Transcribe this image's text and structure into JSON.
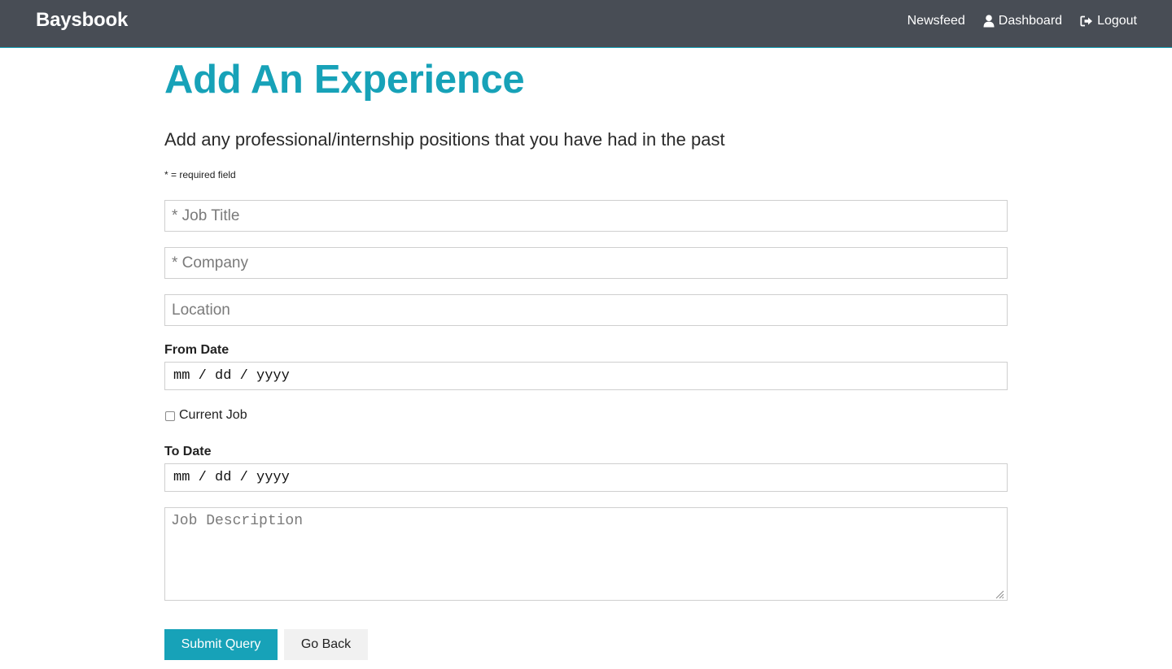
{
  "navbar": {
    "brand": "Baysbook",
    "links": [
      {
        "label": "Newsfeed",
        "icon": "none"
      },
      {
        "label": "Dashboard",
        "icon": "user-icon"
      },
      {
        "label": "Logout",
        "icon": "sign-out-icon"
      }
    ]
  },
  "page": {
    "title": "Add An Experience",
    "lead": "Add any professional/internship positions that you have had in the past",
    "required_note": "* = required field"
  },
  "form": {
    "job_title_placeholder": "* Job Title",
    "company_placeholder": "* Company",
    "location_placeholder": "Location",
    "from_date_label": "From Date",
    "from_date_value": "mm / dd / yyyy",
    "current_job_label": "Current Job",
    "current_job_checked": false,
    "to_date_label": "To Date",
    "to_date_value": "mm / dd / yyyy",
    "description_placeholder": "Job Description",
    "submit_label": "Submit Query",
    "back_label": "Go Back"
  },
  "colors": {
    "navbar_bg": "#484d55",
    "accent": "#17a2b8",
    "button_secondary": "#f1f1f1"
  }
}
